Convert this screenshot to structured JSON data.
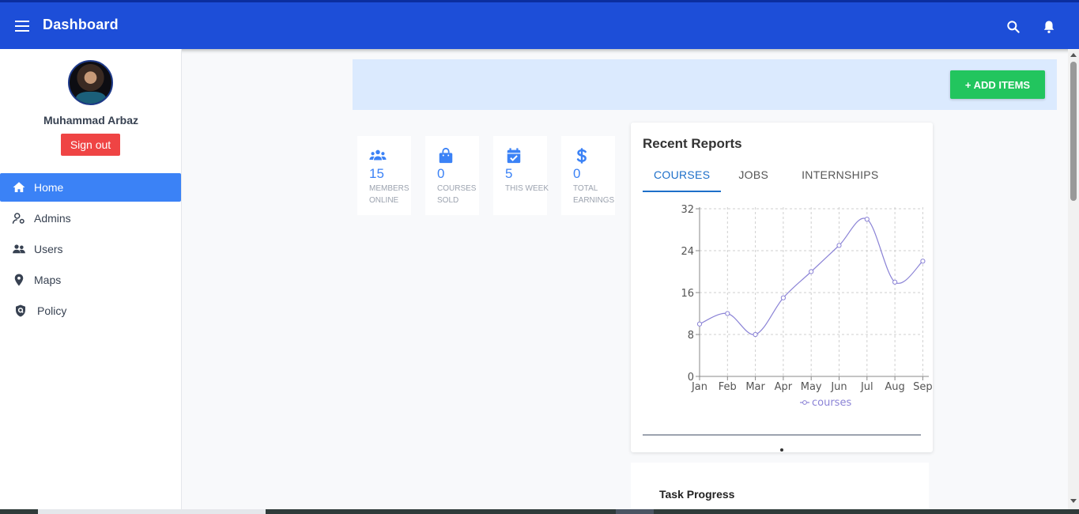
{
  "header": {
    "title": "Dashboard",
    "menu_icon": "hamburger-menu-icon",
    "search_icon": "search-icon",
    "notifications_icon": "bell-icon"
  },
  "sidebar": {
    "user_name": "Muhammad Arbaz",
    "signout_label": "Sign out",
    "items": [
      {
        "label": "Home",
        "icon": "home-icon",
        "active": true
      },
      {
        "label": "Admins",
        "icon": "admin-icon"
      },
      {
        "label": "Users",
        "icon": "users-icon"
      },
      {
        "label": "Maps",
        "icon": "map-pin-icon"
      },
      {
        "label": "Policy",
        "icon": "shield-icon"
      }
    ]
  },
  "toolbar": {
    "add_items_label": "+ ADD ITEMS"
  },
  "stats": [
    {
      "value": "15",
      "label": "MEMBERS ONLINE",
      "icon": "users-icon"
    },
    {
      "value": "0",
      "label": "COURSES SOLD",
      "icon": "shopping-bag-icon"
    },
    {
      "value": "5",
      "label": "THIS WEEK",
      "icon": "calendar-check-icon"
    },
    {
      "value": "0",
      "label": "TOTAL EARNINGS",
      "icon": "dollar-icon"
    }
  ],
  "reports": {
    "title": "Recent Reports",
    "tabs": [
      "COURSES",
      "JOBS",
      "INTERNSHIPS"
    ],
    "active_tab": "COURSES"
  },
  "chart_data": {
    "type": "line",
    "categories": [
      "Jan",
      "Feb",
      "Mar",
      "Apr",
      "May",
      "Jun",
      "Jul",
      "Aug",
      "Sep"
    ],
    "series": [
      {
        "name": "courses",
        "values": [
          10,
          12,
          8,
          15,
          20,
          25,
          30,
          18,
          22
        ],
        "color": "#8b83d6"
      }
    ],
    "yticks": [
      0,
      8,
      16,
      24,
      32
    ],
    "ylim": [
      0,
      32
    ],
    "grid": true,
    "legend": "bottom"
  },
  "task": {
    "title": "Task Progress"
  },
  "colors": {
    "header": "#1d4ed8",
    "accent": "#3b82f6",
    "danger": "#ef4444",
    "success": "#22c55e",
    "banner": "#dbeafe"
  }
}
